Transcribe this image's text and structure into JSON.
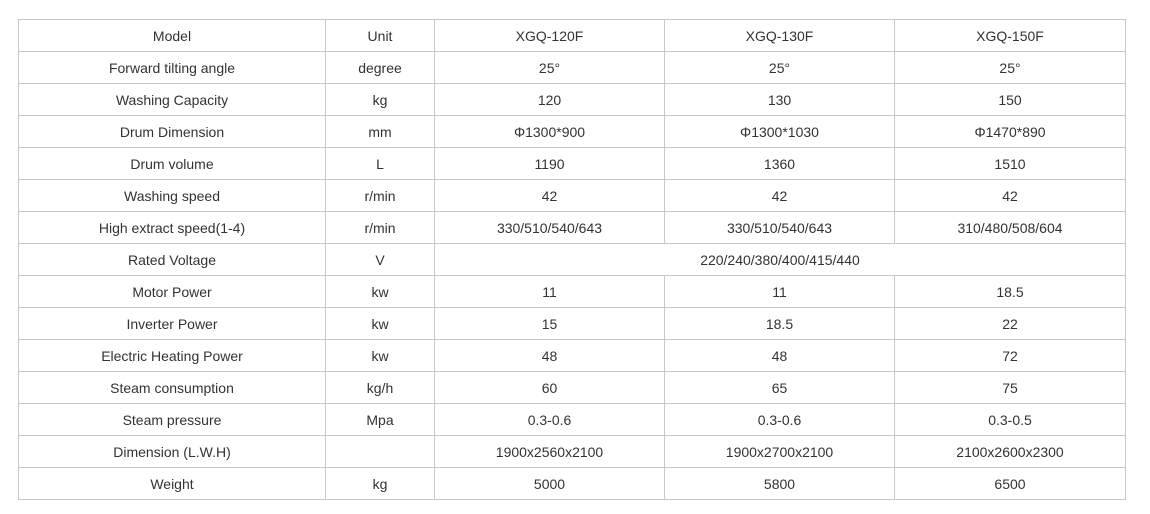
{
  "table": {
    "header": {
      "label": "Model",
      "unit": "Unit",
      "models": [
        "XGQ-120F",
        "XGQ-130F",
        "XGQ-150F"
      ]
    },
    "rows": [
      {
        "label": "Forward tilting angle",
        "unit": "degree",
        "values": [
          "25°",
          "25°",
          "25°"
        ]
      },
      {
        "label": "Washing Capacity",
        "unit": "kg",
        "values": [
          "120",
          "130",
          "150"
        ]
      },
      {
        "label": "Drum Dimension",
        "unit": "mm",
        "values": [
          "Φ1300*900",
          "Φ1300*1030",
          "Φ1470*890"
        ]
      },
      {
        "label": "Drum volume",
        "unit": "L",
        "values": [
          "1190",
          "1360",
          "1510"
        ]
      },
      {
        "label": "Washing speed",
        "unit": "r/min",
        "values": [
          "42",
          "42",
          "42"
        ]
      },
      {
        "label": "High extract speed(1-4)",
        "unit": "r/min",
        "values": [
          "330/510/540/643",
          "330/510/540/643",
          "310/480/508/604"
        ]
      },
      {
        "label": "Rated Voltage",
        "unit": "V",
        "merged_value": "220/240/380/400/415/440"
      },
      {
        "label": "Motor Power",
        "unit": "kw",
        "values": [
          "11",
          "11",
          "18.5"
        ]
      },
      {
        "label": "Inverter Power",
        "unit": "kw",
        "values": [
          "15",
          "18.5",
          "22"
        ]
      },
      {
        "label": "Electric Heating Power",
        "unit": "kw",
        "values": [
          "48",
          "48",
          "72"
        ]
      },
      {
        "label": "Steam consumption",
        "unit": "kg/h",
        "values": [
          "60",
          "65",
          "75"
        ]
      },
      {
        "label": "Steam pressure",
        "unit": "Mpa",
        "values": [
          "0.3-0.6",
          "0.3-0.6",
          "0.3-0.5"
        ]
      },
      {
        "label": "Dimension (L.W.H)",
        "unit": "",
        "values": [
          "1900x2560x2100",
          "1900x2700x2100",
          "2100x2600x2300"
        ]
      },
      {
        "label": "Weight",
        "unit": "kg",
        "values": [
          "5000",
          "5800",
          "6500"
        ]
      }
    ]
  }
}
